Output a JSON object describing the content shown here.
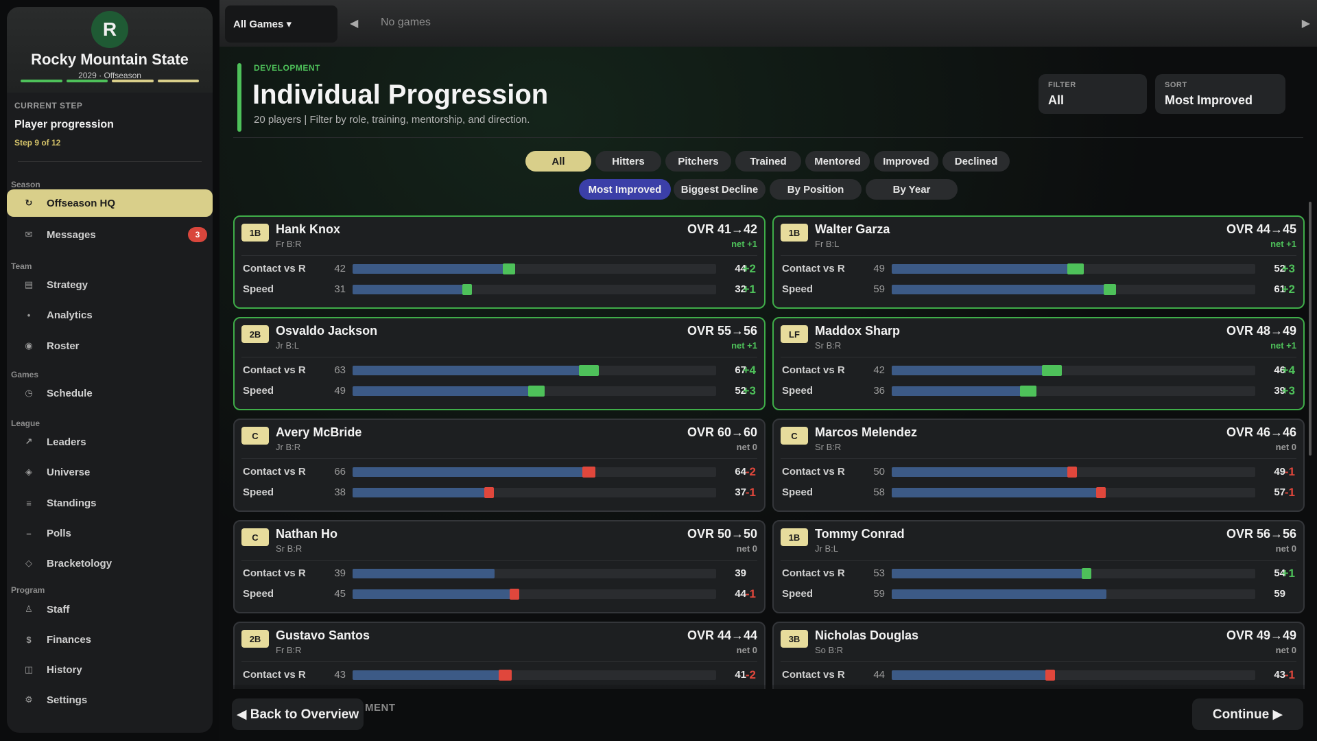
{
  "sidebar": {
    "team": {
      "initial": "R",
      "name": "Rocky Mountain State",
      "season": "2029 · Offseason",
      "colors": [
        "#4ec15a",
        "#4ec15a",
        "#d9cf8a",
        "#d9cf8a"
      ]
    },
    "current_step": {
      "label": "CURRENT STEP",
      "title": "Player progression",
      "count": "Step 9 of 12"
    },
    "sections": [
      {
        "label": "Season",
        "items": [
          {
            "label": "Offseason HQ",
            "icon": "refresh-icon",
            "glyph": "↻",
            "active": true
          },
          {
            "label": "Messages",
            "icon": "mail-icon",
            "glyph": "✉",
            "badge": "3"
          }
        ]
      },
      {
        "label": "Team",
        "items": [
          {
            "label": "Strategy",
            "icon": "strategy-icon",
            "glyph": "▤"
          },
          {
            "label": "Analytics",
            "icon": "analytics-icon",
            "glyph": "•"
          },
          {
            "label": "Roster",
            "icon": "roster-icon",
            "glyph": "◉"
          }
        ]
      },
      {
        "label": "Games",
        "items": [
          {
            "label": "Schedule",
            "icon": "clock-icon",
            "glyph": "◷"
          }
        ]
      },
      {
        "label": "League",
        "items": [
          {
            "label": "Leaders",
            "icon": "trend-icon",
            "glyph": "↗"
          },
          {
            "label": "Universe",
            "icon": "universe-icon",
            "glyph": "◈"
          },
          {
            "label": "Standings",
            "icon": "list-icon",
            "glyph": "≡"
          },
          {
            "label": "Polls",
            "icon": "polls-icon",
            "glyph": "–"
          },
          {
            "label": "Bracketology",
            "icon": "diamond-icon",
            "glyph": "◇"
          }
        ]
      },
      {
        "label": "Program",
        "items": [
          {
            "label": "Staff",
            "icon": "staff-icon",
            "glyph": "♙"
          },
          {
            "label": "Finances",
            "icon": "dollar-icon",
            "glyph": "$"
          },
          {
            "label": "History",
            "icon": "book-icon",
            "glyph": "◫"
          },
          {
            "label": "Settings",
            "icon": "gear-icon",
            "glyph": "⚙"
          }
        ]
      }
    ]
  },
  "topbar": {
    "games_select": "All Games ▾",
    "no_games": "No games",
    "prev": "◀",
    "next": "▶"
  },
  "header": {
    "kicker": "DEVELOPMENT",
    "title": "Individual Progression",
    "subtitle": "20 players | Filter by role, training, mentorship, and direction.",
    "filter": {
      "label": "FILTER",
      "value": "All"
    },
    "sort": {
      "label": "SORT",
      "value": "Most Improved"
    }
  },
  "filter_chips": [
    "All",
    "Hitters",
    "Pitchers",
    "Trained",
    "Mentored",
    "Improved",
    "Declined"
  ],
  "sort_chips": [
    "Most Improved",
    "Biggest Decline",
    "By Position",
    "By Year"
  ],
  "colors": {
    "up": "#4ec15a",
    "down": "#e0473c",
    "bar": "#3c5a86",
    "accent": "#d9cf8a"
  },
  "stat_max": 100,
  "players": [
    {
      "pos": "1B",
      "name": "Hank Knox",
      "meta": "Fr  B:R",
      "ovr": "OVR 41→42",
      "net": "net +1",
      "improved": true,
      "stats": [
        {
          "name": "Contact vs R",
          "from": 42,
          "to": 44,
          "delta": "+2"
        },
        {
          "name": "Speed",
          "from": 31,
          "to": 32,
          "delta": "+1"
        }
      ]
    },
    {
      "pos": "1B",
      "name": "Walter Garza",
      "meta": "Fr  B:L",
      "ovr": "OVR 44→45",
      "net": "net +1",
      "improved": true,
      "stats": [
        {
          "name": "Contact vs R",
          "from": 49,
          "to": 52,
          "delta": "+3"
        },
        {
          "name": "Speed",
          "from": 59,
          "to": 61,
          "delta": "+2"
        }
      ]
    },
    {
      "pos": "2B",
      "name": "Osvaldo Jackson",
      "meta": "Jr  B:L",
      "ovr": "OVR 55→56",
      "net": "net +1",
      "improved": true,
      "stats": [
        {
          "name": "Contact vs R",
          "from": 63,
          "to": 67,
          "delta": "+4"
        },
        {
          "name": "Speed",
          "from": 49,
          "to": 52,
          "delta": "+3"
        }
      ]
    },
    {
      "pos": "LF",
      "name": "Maddox Sharp",
      "meta": "Sr  B:R",
      "ovr": "OVR 48→49",
      "net": "net +1",
      "improved": true,
      "stats": [
        {
          "name": "Contact vs R",
          "from": 42,
          "to": 46,
          "delta": "+4"
        },
        {
          "name": "Speed",
          "from": 36,
          "to": 39,
          "delta": "+3"
        }
      ]
    },
    {
      "pos": "C",
      "name": "Avery McBride",
      "meta": "Jr  B:R",
      "ovr": "OVR 60→60",
      "net": "net 0",
      "improved": false,
      "stats": [
        {
          "name": "Contact vs R",
          "from": 66,
          "to": 64,
          "delta": "-2"
        },
        {
          "name": "Speed",
          "from": 38,
          "to": 37,
          "delta": "-1"
        }
      ]
    },
    {
      "pos": "C",
      "name": "Marcos Melendez",
      "meta": "Sr  B:R",
      "ovr": "OVR 46→46",
      "net": "net 0",
      "improved": false,
      "stats": [
        {
          "name": "Contact vs R",
          "from": 50,
          "to": 49,
          "delta": "-1"
        },
        {
          "name": "Speed",
          "from": 58,
          "to": 57,
          "delta": "-1"
        }
      ]
    },
    {
      "pos": "C",
      "name": "Nathan Ho",
      "meta": "Sr  B:R",
      "ovr": "OVR 50→50",
      "net": "net 0",
      "improved": false,
      "stats": [
        {
          "name": "Contact vs R",
          "from": 39,
          "to": 39,
          "delta": ""
        },
        {
          "name": "Speed",
          "from": 45,
          "to": 44,
          "delta": "-1"
        }
      ]
    },
    {
      "pos": "1B",
      "name": "Tommy Conrad",
      "meta": "Jr  B:L",
      "ovr": "OVR 56→56",
      "net": "net 0",
      "improved": false,
      "stats": [
        {
          "name": "Contact vs R",
          "from": 53,
          "to": 54,
          "delta": "+1"
        },
        {
          "name": "Speed",
          "from": 59,
          "to": 59,
          "delta": ""
        }
      ]
    },
    {
      "pos": "2B",
      "name": "Gustavo Santos",
      "meta": "Fr  B:R",
      "ovr": "OVR 44→44",
      "net": "net 0",
      "improved": false,
      "stats": [
        {
          "name": "Contact vs R",
          "from": 43,
          "to": 41,
          "delta": "-2"
        }
      ]
    },
    {
      "pos": "3B",
      "name": "Nicholas Douglas",
      "meta": "So  B:R",
      "ovr": "OVR 49→49",
      "net": "net 0",
      "improved": false,
      "stats": [
        {
          "name": "Contact vs R",
          "from": 44,
          "to": 43,
          "delta": "-1"
        }
      ]
    }
  ],
  "footer": {
    "back": "◀ Back to Overview",
    "ghost": "MENT",
    "continue": "Continue ▶"
  }
}
